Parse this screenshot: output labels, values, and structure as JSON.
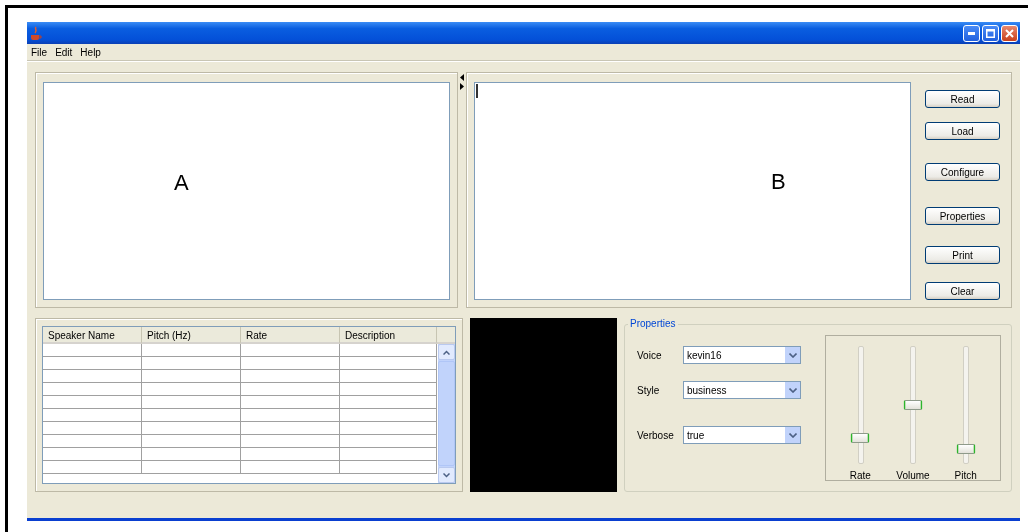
{
  "menu": [
    "File",
    "Edit",
    "Help"
  ],
  "panel_a": {
    "label": "A"
  },
  "panel_b": {
    "label": "B"
  },
  "buttons": [
    "Read",
    "Load",
    "Configure",
    "Properties",
    "Print",
    "Clear"
  ],
  "table": {
    "columns": [
      "Speaker Name",
      "Pitch (Hz)",
      "Rate",
      "Description"
    ]
  },
  "properties": {
    "title": "Properties",
    "fields": [
      {
        "label": "Voice",
        "value": "kevin16"
      },
      {
        "label": "Style",
        "value": "business"
      },
      {
        "label": "Verbose",
        "value": "true"
      }
    ],
    "sliders": [
      {
        "label": "Rate",
        "level": 0.2
      },
      {
        "label": "Volume",
        "level": 0.5
      },
      {
        "label": "Pitch",
        "level": 0.1
      }
    ]
  }
}
